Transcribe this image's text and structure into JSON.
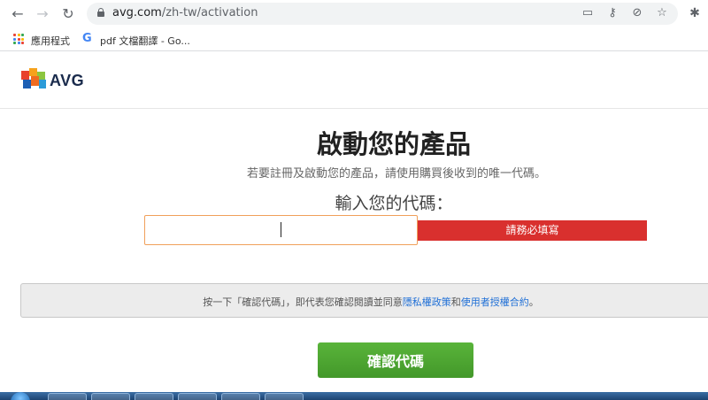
{
  "browser": {
    "url_host": "avg.com",
    "url_path": "/zh-tw/activation",
    "bookmarks": [
      {
        "label": "應用程式"
      },
      {
        "label": "pdf 文檔翻譯 - Go..."
      }
    ]
  },
  "header": {
    "logo_text": "AVG"
  },
  "main": {
    "title": "啟動您的產品",
    "subtitle": "若要註冊及啟動您的產品，請使用購買後收到的唯一代碼。",
    "code_label": "輸入您的代碼：",
    "code_value": "",
    "error_text": "請務必填寫",
    "notice_prefix": "按一下「確認代碼」，即代表您確認閱讀並同意",
    "privacy_link": "隱私權政策",
    "notice_and": "和",
    "terms_link": "使用者授權合約",
    "notice_suffix": "。",
    "confirm_button": "確認代碼"
  },
  "colors": {
    "error": "#d9302e",
    "confirm": "#4ca530",
    "link": "#1f6fd6",
    "input_border": "#f0a05a"
  },
  "icons": {
    "back": "arrow-left-icon",
    "forward": "arrow-right-icon",
    "reload": "reload-icon",
    "lock": "lock-icon",
    "cast": "cast-icon",
    "key": "key-icon",
    "eye_off": "eye-off-icon",
    "star": "star-icon",
    "extensions": "puzzle-icon",
    "apps": "apps-grid-icon",
    "google": "google-icon"
  }
}
